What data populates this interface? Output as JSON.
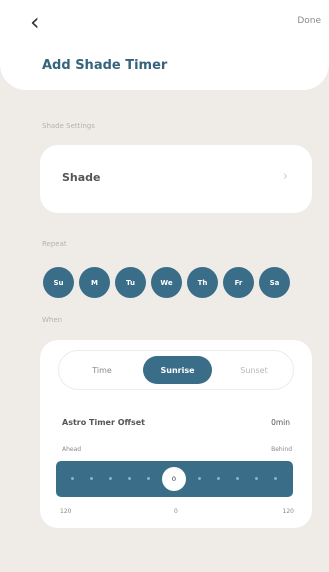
{
  "nav": {
    "back_icon": "chevron-left-icon",
    "back_glyph": "‹",
    "done_label": "Done"
  },
  "page": {
    "title": "Add Shade Timer"
  },
  "shade_settings": {
    "section_label": "Shade Settings",
    "item_label": "Shade",
    "chevron_icon": "chevron-right-icon",
    "chevron_glyph": "›"
  },
  "repeat": {
    "section_label": "Repeat",
    "days": [
      {
        "label": "Su",
        "selected": true
      },
      {
        "label": "M",
        "selected": true
      },
      {
        "label": "Tu",
        "selected": true
      },
      {
        "label": "We",
        "selected": true
      },
      {
        "label": "Th",
        "selected": true
      },
      {
        "label": "Fr",
        "selected": true
      },
      {
        "label": "Sa",
        "selected": true
      }
    ]
  },
  "when": {
    "section_label": "When",
    "modes": [
      {
        "label": "Time",
        "selected": false
      },
      {
        "label": "Sunrise",
        "selected": true
      },
      {
        "label": "Sunset",
        "selected": false
      }
    ],
    "offset_label": "Astro Timer Offset",
    "offset_value": "0min",
    "ahead_label": "Ahead",
    "behind_label": "Behind",
    "slider": {
      "value": 0,
      "min_label": "120",
      "mid_label": "0",
      "max_label": "120",
      "thumb_label": "0"
    }
  },
  "colors": {
    "accent": "#3a6d88",
    "title": "#36647c",
    "background": "#efece8"
  }
}
